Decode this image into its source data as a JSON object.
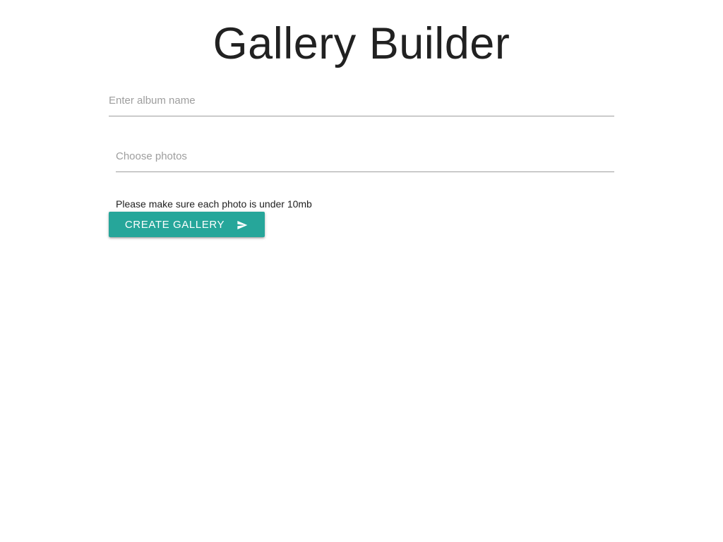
{
  "page": {
    "title": "Gallery Builder"
  },
  "form": {
    "album_name": {
      "placeholder": "Enter album name",
      "value": ""
    },
    "photos": {
      "placeholder": "Choose photos",
      "value": ""
    },
    "hint": "Please make sure each photo is under 10mb",
    "submit_label": "Create Gallery",
    "submit_icon": "send-icon"
  },
  "colors": {
    "accent": "#26a69a",
    "text": "#212121",
    "placeholder": "#9e9e9e",
    "underline": "#9e9e9e"
  }
}
